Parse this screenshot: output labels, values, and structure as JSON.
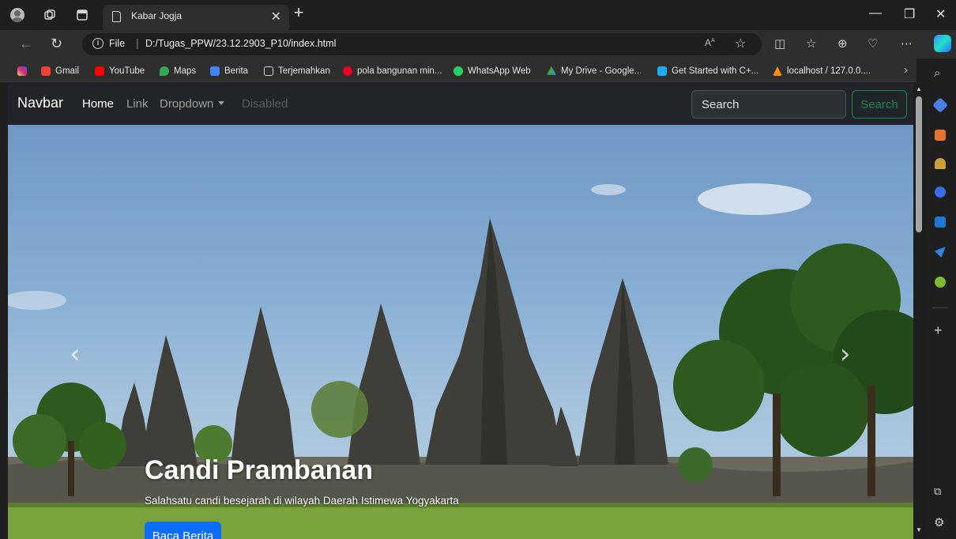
{
  "browser": {
    "tab": {
      "title": "Kabar Jogja"
    },
    "address": {
      "scheme": "File",
      "url": "D:/Tugas_PPW/23.12.2903_P10/index.html"
    },
    "favorites": [
      {
        "label": "",
        "icon": "instagram-icon",
        "color": "#e1306c"
      },
      {
        "label": "Gmail",
        "icon": "gmail-icon",
        "color": "#ea4335"
      },
      {
        "label": "YouTube",
        "icon": "youtube-icon",
        "color": "#ff0000"
      },
      {
        "label": "Maps",
        "icon": "maps-icon",
        "color": "#34a853"
      },
      {
        "label": "Berita",
        "icon": "google-sites-icon",
        "color": "#4285f4"
      },
      {
        "label": "Terjemahkan",
        "icon": "page-icon",
        "color": "#cfcfcf"
      },
      {
        "label": "pola bangunan min...",
        "icon": "pinterest-icon",
        "color": "#e60023"
      },
      {
        "label": "WhatsApp Web",
        "icon": "whatsapp-icon",
        "color": "#25d366"
      },
      {
        "label": "My Drive - Google...",
        "icon": "google-drive-icon",
        "color": "#fbbc04"
      },
      {
        "label": "Get Started with C+...",
        "icon": "vscode-icon",
        "color": "#23a9f2"
      },
      {
        "label": "localhost / 127.0.0....",
        "icon": "phpmyadmin-icon",
        "color": "#f29111"
      }
    ]
  },
  "navbar": {
    "brand": "Navbar",
    "links": {
      "home": "Home",
      "link": "Link",
      "dropdown": "Dropdown",
      "disabled": "Disabled"
    },
    "search": {
      "placeholder": "Search",
      "button": "Search"
    }
  },
  "carousel": {
    "caption_title": "Candi Prambanan",
    "caption_text": "Salahsatu candi besejarah di wilayah Daerah Istimewa Yogyakarta",
    "button": "Baca Berita"
  },
  "colors": {
    "navbar_bg": "#212529",
    "primary": "#0d6efd",
    "success": "#198754"
  }
}
